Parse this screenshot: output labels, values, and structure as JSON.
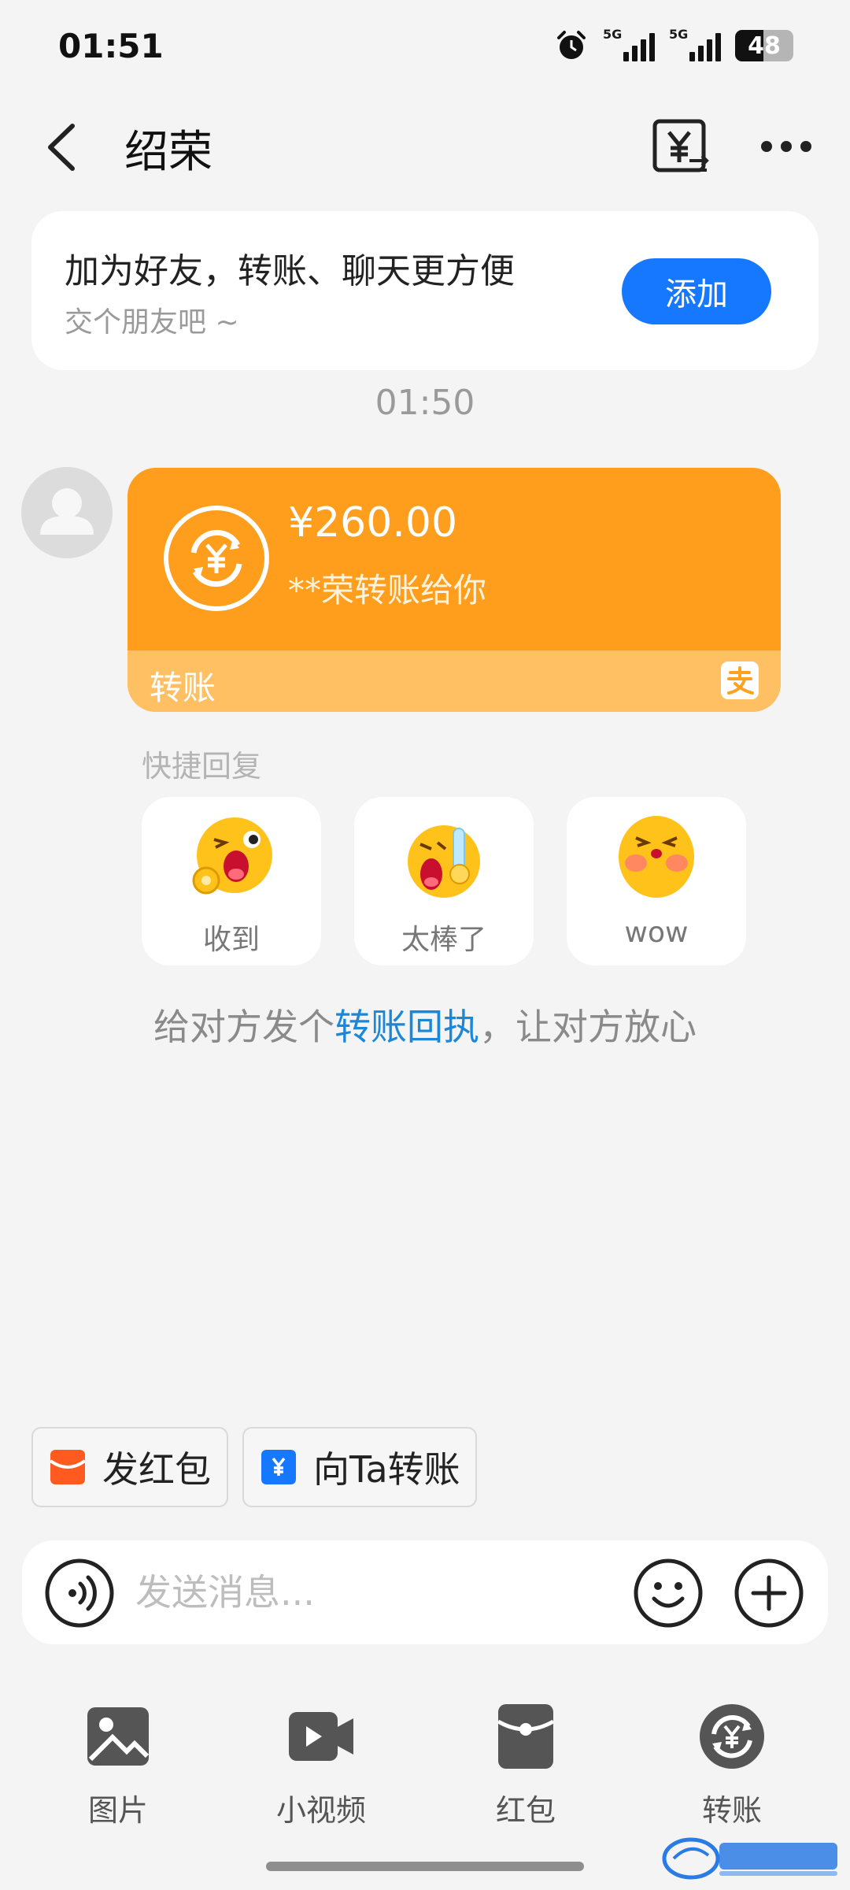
{
  "status_bar": {
    "time": "01:51",
    "net1": "5G",
    "net2": "5G",
    "battery": "48",
    "battery_level": 0.48
  },
  "header": {
    "title": "绍荣"
  },
  "friend_card": {
    "title": "加为好友，转账、聊天更方便",
    "subtitle": "交个朋友吧 ~",
    "add_label": "添加"
  },
  "message_time": "01:50",
  "transfer": {
    "amount": "¥260.00",
    "desc": "**荣转账给你",
    "label": "转账"
  },
  "quick_reply": {
    "title": "快捷回复",
    "items": [
      {
        "label": "收到",
        "icon": "ok-emoji-icon"
      },
      {
        "label": "太棒了",
        "icon": "thumbs-emoji-icon"
      },
      {
        "label": "wow",
        "icon": "blush-emoji-icon"
      }
    ]
  },
  "hint": {
    "prefix": "给对方发个",
    "link": "转账回执",
    "suffix": "，让对方放心"
  },
  "shortcuts": {
    "red_packet": "发红包",
    "transfer": "向Ta转账"
  },
  "input": {
    "placeholder": "发送消息..."
  },
  "toolbar": {
    "photo": "图片",
    "video": "小视频",
    "red_packet": "红包",
    "transfer": "转账"
  },
  "colors": {
    "accent": "#1677ff",
    "transfer_orange": "#ff9d1c",
    "link": "#1a87d8"
  }
}
